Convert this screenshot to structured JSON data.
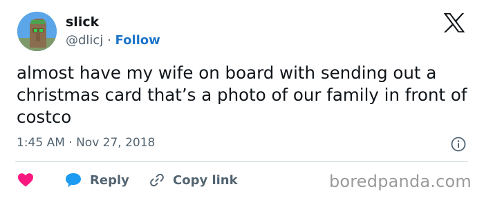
{
  "author": {
    "display_name": "slick",
    "handle": "@dlicj",
    "separator": "·",
    "follow_label": "Follow"
  },
  "platform_icon": "x-logo-icon",
  "tweet": {
    "text": "almost have my wife on board with sending out a christmas card that’s a photo of our family in front of costco",
    "timestamp": "1:45 AM · Nov 27, 2018"
  },
  "actions": {
    "like_icon": "heart-icon",
    "reply_label": "Reply",
    "copy_label": "Copy link"
  },
  "watermark": "boredpanda.com",
  "colors": {
    "text": "#0f1419",
    "muted": "#536471",
    "accent": "#1d75c9",
    "heart": "#f91880",
    "reply_bubble": "#1d9bf0",
    "divider": "#cfd9de"
  }
}
